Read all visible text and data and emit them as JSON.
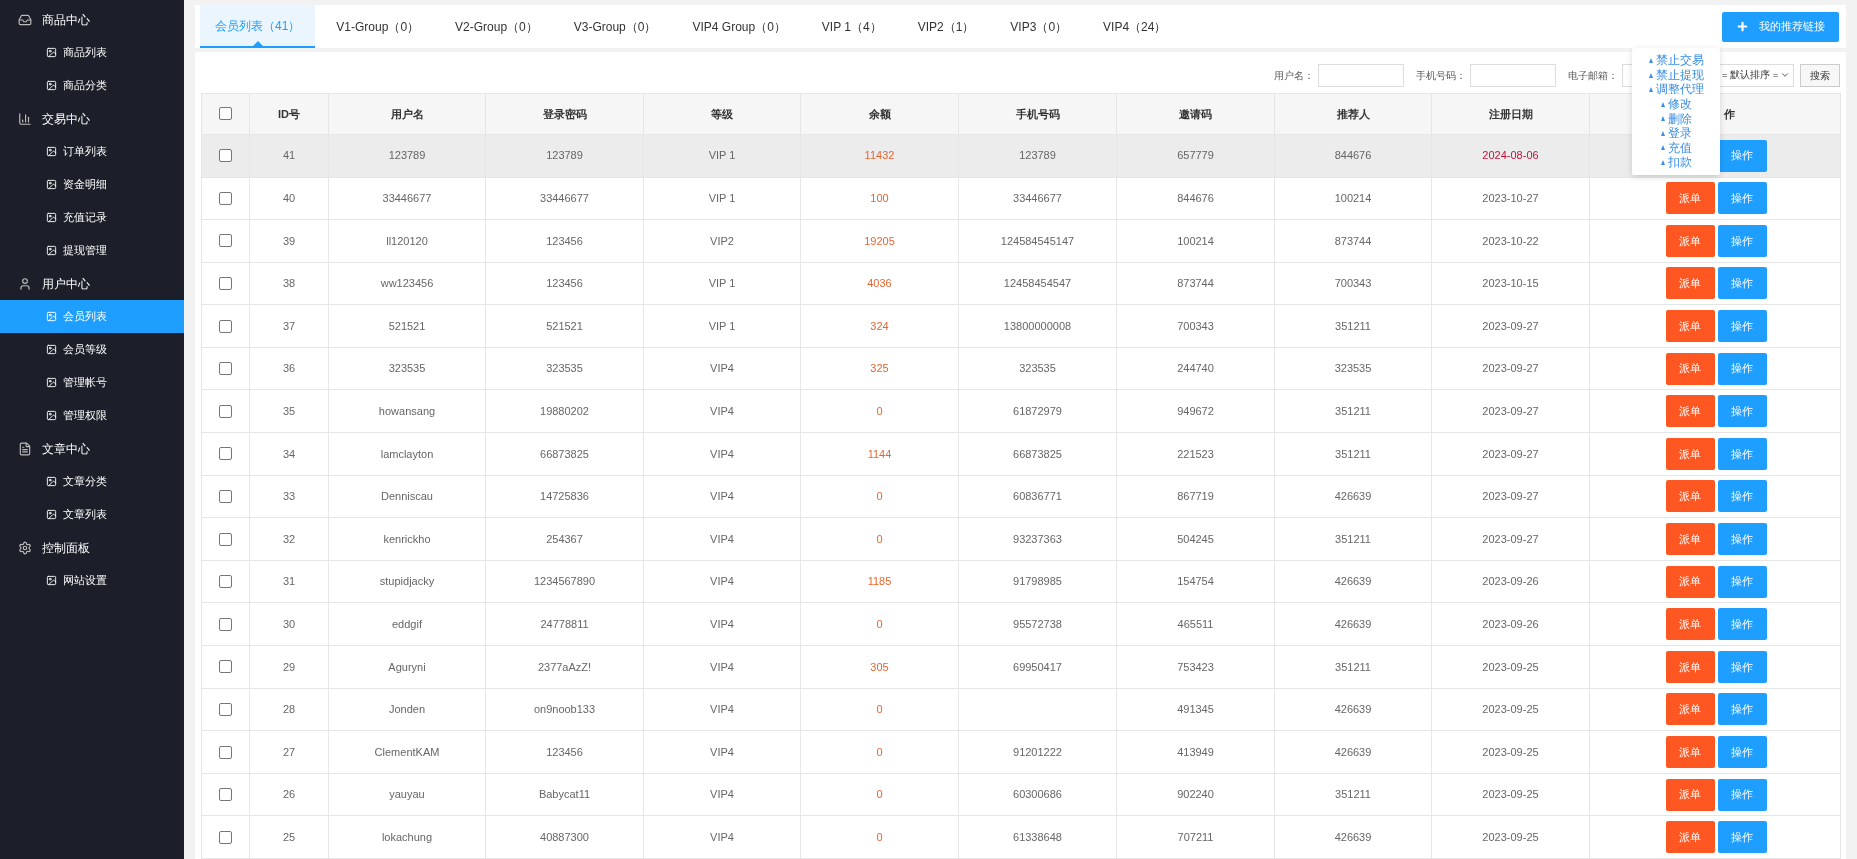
{
  "sidebar": {
    "groups": [
      {
        "kind": "tray",
        "label": "商品中心",
        "children": [
          {
            "label": "商品列表",
            "selected": false
          },
          {
            "label": "商品分类",
            "selected": false
          }
        ]
      },
      {
        "kind": "chart",
        "label": "交易中心",
        "children": [
          {
            "label": "订单列表",
            "selected": false
          },
          {
            "label": "资金明细",
            "selected": false
          },
          {
            "label": "充值记录",
            "selected": false
          },
          {
            "label": "提现管理",
            "selected": false
          }
        ]
      },
      {
        "kind": "user",
        "label": "用户中心",
        "children": [
          {
            "label": "会员列表",
            "selected": true
          },
          {
            "label": "会员等级",
            "selected": false
          },
          {
            "label": "管理帐号",
            "selected": false
          },
          {
            "label": "管理权限",
            "selected": false
          }
        ]
      },
      {
        "kind": "doc",
        "label": "文章中心",
        "children": [
          {
            "label": "文章分类",
            "selected": false
          },
          {
            "label": "文章列表",
            "selected": false
          }
        ]
      },
      {
        "kind": "gear",
        "label": "控制面板",
        "children": [
          {
            "label": "网站设置",
            "selected": false
          }
        ]
      }
    ]
  },
  "tabs": [
    {
      "label": "会员列表（41）",
      "selected": true
    },
    {
      "label": "V1-Group（0）",
      "selected": false
    },
    {
      "label": "V2-Group（0）",
      "selected": false
    },
    {
      "label": "V3-Group（0）",
      "selected": false
    },
    {
      "label": "VIP4 Group（0）",
      "selected": false
    },
    {
      "label": "VIP 1（4）",
      "selected": false
    },
    {
      "label": "VIP2（1）",
      "selected": false
    },
    {
      "label": "VIP3（0）",
      "selected": false
    },
    {
      "label": "VIP4（24）",
      "selected": false
    }
  ],
  "referral_button": "我的推荐链接",
  "search": {
    "fields": [
      {
        "label": "用户名："
      },
      {
        "label": "手机号码："
      },
      {
        "label": "电子邮箱："
      }
    ],
    "sort": "= 默认排序 =",
    "button": "搜索"
  },
  "action_menu": [
    "禁止交易",
    "禁止提现",
    "调整代理",
    "修改",
    "删除",
    "登录",
    "充值",
    "扣款"
  ],
  "table": {
    "all_checked": false,
    "columns": [
      "ID号",
      "用户名",
      "登录密码",
      "等级",
      "余额",
      "手机号码",
      "邀请码",
      "推荐人",
      "注册日期",
      "作"
    ],
    "rows": [
      {
        "id": "41",
        "username": "123789",
        "password": "123789",
        "grade": "VIP 1",
        "balance": "11432",
        "phone": "123789",
        "invite_code": "657779",
        "referrer": "844676",
        "date": "2024-08-06",
        "checked": false,
        "highlighted": true,
        "recent": true,
        "actions": [
          {
            "kind": "operate",
            "label": "操作"
          }
        ]
      },
      {
        "id": "40",
        "username": "33446677",
        "password": "33446677",
        "grade": "VIP 1",
        "balance": "100",
        "phone": "33446677",
        "invite_code": "844676",
        "referrer": "100214",
        "date": "2023-10-27",
        "checked": false,
        "highlighted": false,
        "recent": false,
        "actions": [
          {
            "kind": "dispatch",
            "label": "派单"
          },
          {
            "kind": "operate",
            "label": "操作"
          }
        ]
      },
      {
        "id": "39",
        "username": "ll120120",
        "password": "123456",
        "grade": "VIP2",
        "balance": "19205",
        "phone": "124584545147",
        "invite_code": "100214",
        "referrer": "873744",
        "date": "2023-10-22",
        "checked": false,
        "highlighted": false,
        "recent": false,
        "actions": [
          {
            "kind": "dispatch",
            "label": "派单"
          },
          {
            "kind": "operate",
            "label": "操作"
          }
        ]
      },
      {
        "id": "38",
        "username": "ww123456",
        "password": "123456",
        "grade": "VIP 1",
        "balance": "4036",
        "phone": "12458454547",
        "invite_code": "873744",
        "referrer": "700343",
        "date": "2023-10-15",
        "checked": false,
        "highlighted": false,
        "recent": false,
        "actions": [
          {
            "kind": "dispatch",
            "label": "派单"
          },
          {
            "kind": "operate",
            "label": "操作"
          }
        ]
      },
      {
        "id": "37",
        "username": "521521",
        "password": "521521",
        "grade": "VIP 1",
        "balance": "324",
        "phone": "13800000008",
        "invite_code": "700343",
        "referrer": "351211",
        "date": "2023-09-27",
        "checked": false,
        "highlighted": false,
        "recent": false,
        "actions": [
          {
            "kind": "dispatch",
            "label": "派单"
          },
          {
            "kind": "operate",
            "label": "操作"
          }
        ]
      },
      {
        "id": "36",
        "username": "323535",
        "password": "323535",
        "grade": "VIP4",
        "balance": "325",
        "phone": "323535",
        "invite_code": "244740",
        "referrer": "323535",
        "date": "2023-09-27",
        "checked": false,
        "highlighted": false,
        "recent": false,
        "actions": [
          {
            "kind": "dispatch",
            "label": "派单"
          },
          {
            "kind": "operate",
            "label": "操作"
          }
        ]
      },
      {
        "id": "35",
        "username": "howansang",
        "password": "19880202",
        "grade": "VIP4",
        "balance": "0",
        "phone": "61872979",
        "invite_code": "949672",
        "referrer": "351211",
        "date": "2023-09-27",
        "checked": false,
        "highlighted": false,
        "recent": false,
        "actions": [
          {
            "kind": "dispatch",
            "label": "派单"
          },
          {
            "kind": "operate",
            "label": "操作"
          }
        ]
      },
      {
        "id": "34",
        "username": "lamclayton",
        "password": "66873825",
        "grade": "VIP4",
        "balance": "1144",
        "phone": "66873825",
        "invite_code": "221523",
        "referrer": "351211",
        "date": "2023-09-27",
        "checked": false,
        "highlighted": false,
        "recent": false,
        "actions": [
          {
            "kind": "dispatch",
            "label": "派单"
          },
          {
            "kind": "operate",
            "label": "操作"
          }
        ]
      },
      {
        "id": "33",
        "username": "Denniscau",
        "password": "14725836",
        "grade": "VIP4",
        "balance": "0",
        "phone": "60836771",
        "invite_code": "867719",
        "referrer": "426639",
        "date": "2023-09-27",
        "checked": false,
        "highlighted": false,
        "recent": false,
        "actions": [
          {
            "kind": "dispatch",
            "label": "派单"
          },
          {
            "kind": "operate",
            "label": "操作"
          }
        ]
      },
      {
        "id": "32",
        "username": "kenrickho",
        "password": "254367",
        "grade": "VIP4",
        "balance": "0",
        "phone": "93237363",
        "invite_code": "504245",
        "referrer": "351211",
        "date": "2023-09-27",
        "checked": false,
        "highlighted": false,
        "recent": false,
        "actions": [
          {
            "kind": "dispatch",
            "label": "派单"
          },
          {
            "kind": "operate",
            "label": "操作"
          }
        ]
      },
      {
        "id": "31",
        "username": "stupidjacky",
        "password": "1234567890",
        "grade": "VIP4",
        "balance": "1185",
        "phone": "91798985",
        "invite_code": "154754",
        "referrer": "426639",
        "date": "2023-09-26",
        "checked": false,
        "highlighted": false,
        "recent": false,
        "actions": [
          {
            "kind": "dispatch",
            "label": "派单"
          },
          {
            "kind": "operate",
            "label": "操作"
          }
        ]
      },
      {
        "id": "30",
        "username": "eddgif",
        "password": "24778811",
        "grade": "VIP4",
        "balance": "0",
        "phone": "95572738",
        "invite_code": "465511",
        "referrer": "426639",
        "date": "2023-09-26",
        "checked": false,
        "highlighted": false,
        "recent": false,
        "actions": [
          {
            "kind": "dispatch",
            "label": "派单"
          },
          {
            "kind": "operate",
            "label": "操作"
          }
        ]
      },
      {
        "id": "29",
        "username": "Aguryni",
        "password": "2377aAzZ!",
        "grade": "VIP4",
        "balance": "305",
        "phone": "69950417",
        "invite_code": "753423",
        "referrer": "351211",
        "date": "2023-09-25",
        "checked": false,
        "highlighted": false,
        "recent": false,
        "actions": [
          {
            "kind": "dispatch",
            "label": "派单"
          },
          {
            "kind": "operate",
            "label": "操作"
          }
        ]
      },
      {
        "id": "28",
        "username": "Jonden",
        "password": "on9noob133",
        "grade": "VIP4",
        "balance": "0",
        "invite_code": "491345",
        "referrer": "426639",
        "date": "2023-09-25",
        "checked": false,
        "highlighted": false,
        "recent": false,
        "actions": [
          {
            "kind": "dispatch",
            "label": "派单"
          },
          {
            "kind": "operate",
            "label": "操作"
          }
        ]
      },
      {
        "id": "27",
        "username": "ClementKAM",
        "password": "123456",
        "grade": "VIP4",
        "balance": "0",
        "phone": "91201222",
        "invite_code": "413949",
        "referrer": "426639",
        "date": "2023-09-25",
        "checked": false,
        "highlighted": false,
        "recent": false,
        "actions": [
          {
            "kind": "dispatch",
            "label": "派单"
          },
          {
            "kind": "operate",
            "label": "操作"
          }
        ]
      },
      {
        "id": "26",
        "username": "yauyau",
        "password": "Babycat11",
        "grade": "VIP4",
        "balance": "0",
        "phone": "60300686",
        "invite_code": "902240",
        "referrer": "351211",
        "date": "2023-09-25",
        "checked": false,
        "highlighted": false,
        "recent": false,
        "actions": [
          {
            "kind": "dispatch",
            "label": "派单"
          },
          {
            "kind": "operate",
            "label": "操作"
          }
        ]
      },
      {
        "id": "25",
        "username": "lokachung",
        "password": "40887300",
        "grade": "VIP4",
        "balance": "0",
        "phone": "61338648",
        "invite_code": "707211",
        "referrer": "426639",
        "date": "2023-09-25",
        "checked": false,
        "highlighted": false,
        "recent": false,
        "actions": [
          {
            "kind": "dispatch",
            "label": "派单"
          },
          {
            "kind": "operate",
            "label": "操作"
          }
        ]
      }
    ]
  }
}
